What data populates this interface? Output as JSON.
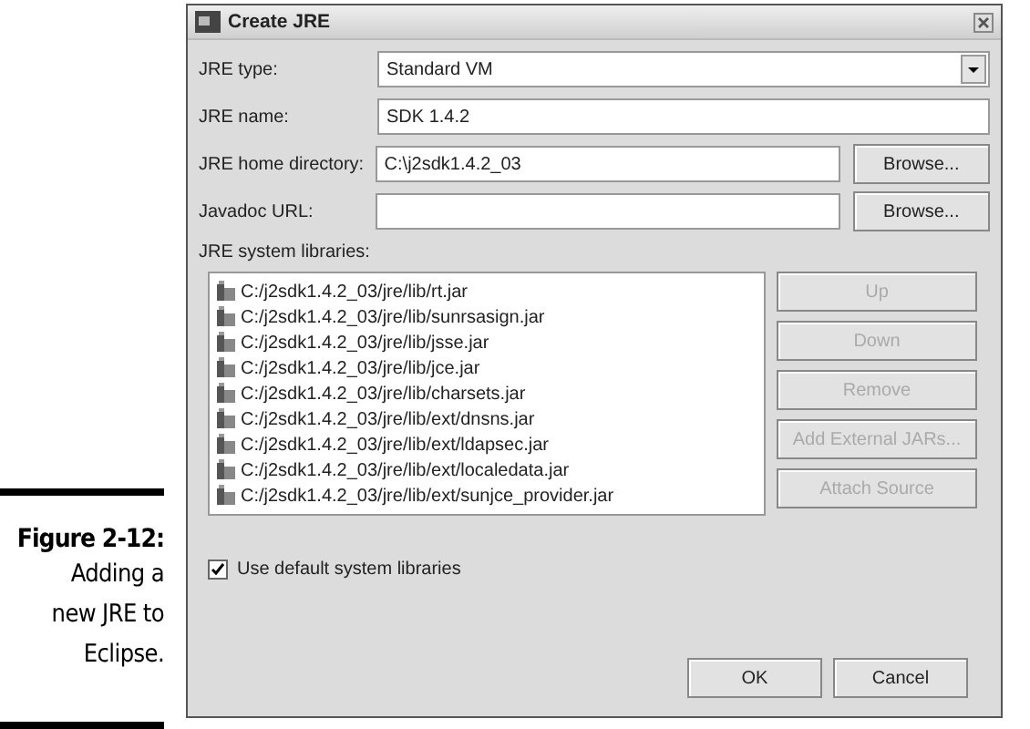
{
  "figure": {
    "label": "Figure 2-12:",
    "caption": "Adding a new JRE to Eclipse."
  },
  "window": {
    "title": "Create JRE"
  },
  "fields": [
    {
      "kind": "dropdown",
      "label": "JRE type:",
      "value": "Standard VM"
    },
    {
      "kind": "text",
      "label": "JRE name:",
      "value": "SDK 1.4.2"
    },
    {
      "kind": "browse",
      "label": "JRE home directory:",
      "value": "C:\\j2sdk1.4.2_03",
      "button": "Browse..."
    },
    {
      "kind": "browse",
      "label": "Javadoc URL:",
      "button": "Browse..."
    }
  ],
  "libraries": {
    "label": "JRE system libraries:",
    "items": [
      "C:/j2sdk1.4.2_03/jre/lib/rt.jar",
      "C:/j2sdk1.4.2_03/jre/lib/sunrsasign.jar",
      "C:/j2sdk1.4.2_03/jre/lib/jsse.jar",
      "C:/j2sdk1.4.2_03/jre/lib/jce.jar",
      "C:/j2sdk1.4.2_03/jre/lib/charsets.jar",
      "C:/j2sdk1.4.2_03/jre/lib/ext/dnsns.jar",
      "C:/j2sdk1.4.2_03/jre/lib/ext/ldapsec.jar",
      "C:/j2sdk1.4.2_03/jre/lib/ext/localedata.jar",
      "C:/j2sdk1.4.2_03/jre/lib/ext/sunjce_provider.jar"
    ],
    "buttons": [
      {
        "label": "Up",
        "disabled": true
      },
      {
        "label": "Down",
        "disabled": true
      },
      {
        "label": "Remove",
        "disabled": true
      },
      {
        "label": "Add External JARs...",
        "disabled": true
      },
      {
        "label": "Attach Source",
        "disabled": true
      }
    ]
  },
  "use_default": {
    "label": "Use default system libraries",
    "checked": true
  },
  "buttons": [
    "OK",
    "Cancel"
  ]
}
